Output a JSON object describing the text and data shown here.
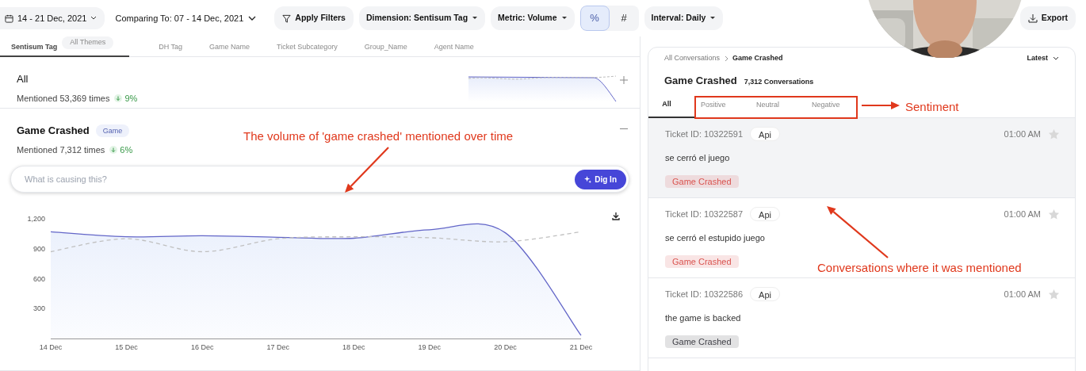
{
  "toolbar": {
    "date_range": "14 - 21 Dec, 2021",
    "comparing": "Comparing To: 07 - 14 Dec, 2021",
    "apply_filters": "Apply Filters",
    "dimension": "Dimension: Sentisum Tag",
    "metric": "Metric: Volume",
    "mode_buttons": [
      {
        "label": "%",
        "selected": true
      },
      {
        "label": "#",
        "selected": false
      }
    ],
    "interval": "Interval: Daily",
    "export": "Export"
  },
  "dimension_tabs": [
    {
      "label": "Sentisum Tag",
      "selected": true
    },
    {
      "label": "DH Tag",
      "selected": false
    },
    {
      "label": "Game Name",
      "selected": false
    },
    {
      "label": "Ticket Subcategory",
      "selected": false
    },
    {
      "label": "Group_Name",
      "selected": false
    },
    {
      "label": "Agent Name",
      "selected": false
    }
  ],
  "theme_filter": "All Themes",
  "themes": [
    {
      "name": "All",
      "mentions": "Mentioned 53,369 times",
      "change": "9%",
      "expanded": false
    },
    {
      "name": "Game Crashed",
      "badge": "Game",
      "mentions": "Mentioned 7,312 times",
      "change": "6%",
      "expanded": true,
      "ask": {
        "placeholder": "What is causing this?",
        "button": "Dig In"
      },
      "chart_data": {
        "type": "line",
        "categories": [
          "14 Dec",
          "15 Dec",
          "16 Dec",
          "17 Dec",
          "18 Dec",
          "19 Dec",
          "20 Dec",
          "21 Dec"
        ],
        "ylim": [
          0,
          1200
        ],
        "yticks": [
          {
            "value": 300,
            "label": "300"
          },
          {
            "value": 600,
            "label": "600"
          },
          {
            "value": 900,
            "label": "900"
          },
          {
            "value": 1200,
            "label": "1,200"
          }
        ],
        "series": [
          {
            "color": "#6366c8",
            "line_style": "solid",
            "values": [
              1070,
              1020,
              1030,
              1015,
              1005,
              1090,
              1060,
              30
            ]
          },
          {
            "color": "#c0c0c0",
            "line_style": "dashed",
            "values": [
              870,
              1000,
              870,
              1000,
              1020,
              1010,
              970,
              1070
            ]
          }
        ]
      }
    }
  ],
  "conversations": {
    "breadcrumb": [
      "All Conversations",
      "Game Crashed"
    ],
    "sort": "Latest",
    "title": "Game Crashed",
    "count": "7,312 Conversations",
    "tabs": [
      {
        "label": "All",
        "selected": true
      },
      {
        "label": "Positive",
        "selected": false
      },
      {
        "label": "Neutral",
        "selected": false
      },
      {
        "label": "Negative",
        "selected": false
      }
    ],
    "items": [
      {
        "ticket": "Ticket ID: 10322591",
        "source": "Api",
        "time": "01:00 AM",
        "starred": false,
        "text": "se cerró el juego",
        "tag": {
          "label": "Game Crashed",
          "color": "#d9534f"
        },
        "selected": true
      },
      {
        "ticket": "Ticket ID: 10322587",
        "source": "Api",
        "time": "01:00 AM",
        "starred": false,
        "text": "se cerró el estupido juego",
        "tag": {
          "label": "Game Crashed",
          "color": "#d9534f"
        },
        "selected": false
      },
      {
        "ticket": "Ticket ID: 10322586",
        "source": "Api",
        "time": "01:00 AM",
        "starred": false,
        "text": "the game is backed",
        "tag": {
          "label": "Game Crashed",
          "color": "#3f3f46"
        },
        "selected": false
      }
    ]
  },
  "annotations": [
    {
      "kind": "chart_note",
      "text": "The volume of 'game crashed' mentioned over time"
    },
    {
      "kind": "sentiment_note",
      "text": "Sentiment"
    },
    {
      "kind": "list_note",
      "text": "Conversations where it was mentioned"
    }
  ]
}
